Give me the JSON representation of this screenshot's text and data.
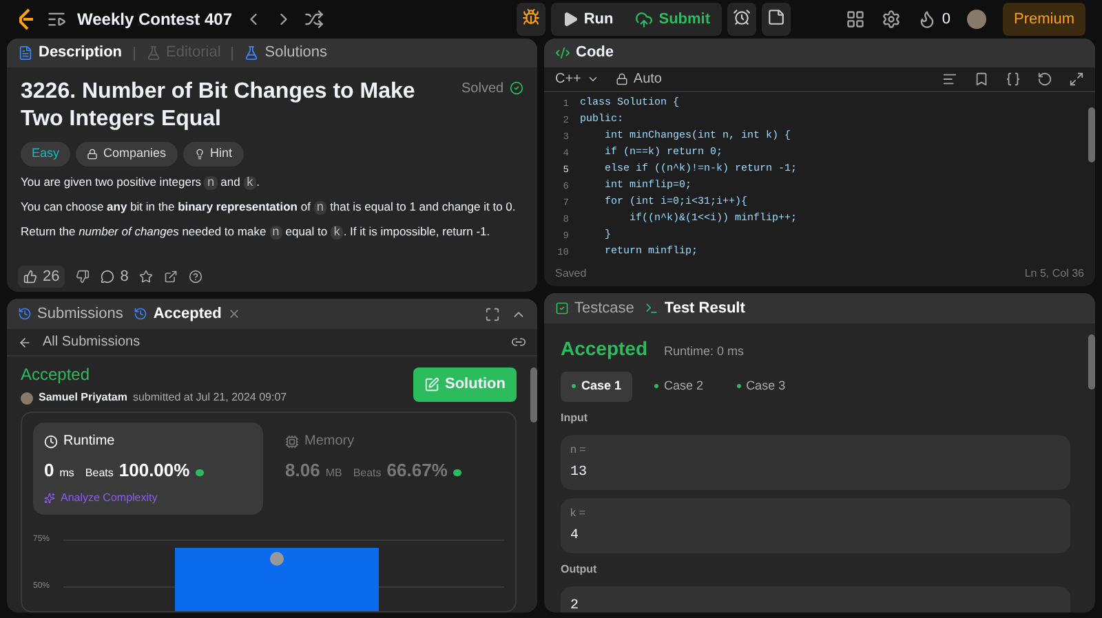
{
  "top_bar": {
    "title": "Weekly Contest 407",
    "run": "Run",
    "submit": "Submit",
    "fire_count": "0",
    "premium": "Premium"
  },
  "description_panel": {
    "tabs": [
      {
        "label": "Description",
        "selected": true,
        "disabled": false
      },
      {
        "label": "Editorial",
        "selected": false,
        "disabled": true
      },
      {
        "label": "Solutions",
        "selected": false,
        "disabled": false
      }
    ],
    "title": "3226. Number of Bit Changes to Make Two Integers Equal",
    "status": "Solved",
    "tags": [
      {
        "label": "Easy",
        "kind": "difficulty"
      },
      {
        "label": "Companies",
        "kind": "lock"
      },
      {
        "label": "Hint",
        "kind": "bulb"
      }
    ],
    "paragraphs": [
      [
        {
          "kind": "text",
          "text": "You are given two positive integers "
        },
        {
          "kind": "code",
          "text": "n"
        },
        {
          "kind": "text",
          "text": " and "
        },
        {
          "kind": "code",
          "text": "k"
        },
        {
          "kind": "text",
          "text": "."
        }
      ],
      [
        {
          "kind": "text",
          "text": "You can choose **any** bit in the **binary representation** of "
        },
        {
          "kind": "code",
          "text": "n"
        },
        {
          "kind": "text",
          "text": " that is equal to 1 and change it to 0."
        }
      ],
      [
        {
          "kind": "text",
          "text": "Return the *number of changes* needed to make "
        },
        {
          "kind": "code",
          "text": "n"
        },
        {
          "kind": "text",
          "text": " equal to "
        },
        {
          "kind": "code",
          "text": "k"
        },
        {
          "kind": "text",
          "text": ". If it is impossible, return -1."
        }
      ]
    ],
    "likes": "26",
    "comments": "8"
  },
  "code_panel": {
    "title": "Code",
    "language": "C++",
    "mode": "Auto",
    "lines": [
      {
        "number": "1",
        "text": "class Solution {",
        "current": false
      },
      {
        "number": "2",
        "text": "public:",
        "current": false
      },
      {
        "number": "3",
        "text": "    int minChanges(int n, int k) {",
        "current": false
      },
      {
        "number": "4",
        "text": "    if (n==k) return 0;",
        "current": false
      },
      {
        "number": "5",
        "text": "    else if ((n^k)!=n-k) return -1;",
        "current": true
      },
      {
        "number": "6",
        "text": "    int minflip=0;",
        "current": false
      },
      {
        "number": "7",
        "text": "    for (int i=0;i<31;i++){",
        "current": false
      },
      {
        "number": "8",
        "text": "        if((n^k)&(1<<i)) minflip++;",
        "current": false
      },
      {
        "number": "9",
        "text": "    }",
        "current": false
      },
      {
        "number": "10",
        "text": "    return minflip;",
        "current": false
      }
    ],
    "status": "Saved",
    "cursor": "Ln 5, Col 36"
  },
  "submission_panel": {
    "tabs": [
      {
        "label": "Submissions",
        "selected": false
      },
      {
        "label": "Accepted",
        "selected": true
      }
    ],
    "back": "All Submissions",
    "result": "Accepted",
    "user": "Samuel Priyatam",
    "submitted": "submitted at Jul 21, 2024 09:07",
    "solution_button": "Solution",
    "metrics": [
      {
        "label": "Runtime",
        "value": "0",
        "unit": "ms",
        "beats_label": "Beats",
        "beats": "100.00%",
        "selected": true
      },
      {
        "label": "Memory",
        "value": "8.06",
        "unit": "MB",
        "beats_label": "Beats",
        "beats": "66.67%",
        "selected": false
      }
    ],
    "analyze": "Analyze Complexity",
    "chart_ticks": [
      "75%",
      "50%"
    ]
  },
  "result_panel": {
    "tabs": [
      {
        "label": "Testcase",
        "selected": false
      },
      {
        "label": "Test Result",
        "selected": true
      }
    ],
    "verdict": "Accepted",
    "runtime": "Runtime: 0 ms",
    "cases": [
      {
        "label": "Case 1",
        "selected": true
      },
      {
        "label": "Case 2",
        "selected": false
      },
      {
        "label": "Case 3",
        "selected": false
      }
    ],
    "input_label": "Input",
    "inputs": [
      {
        "name": "n =",
        "value": "13"
      },
      {
        "name": "k =",
        "value": "4"
      }
    ],
    "output_label": "Output",
    "output": "2"
  }
}
